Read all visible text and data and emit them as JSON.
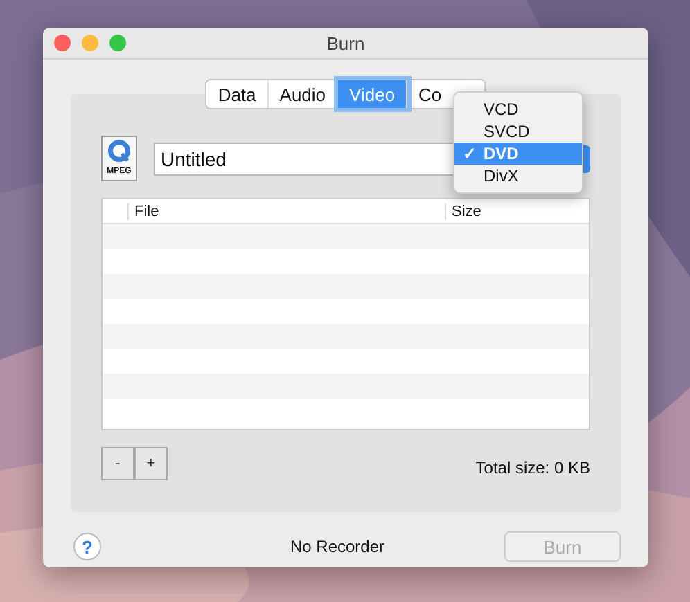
{
  "window": {
    "title": "Burn"
  },
  "tabs": [
    {
      "label": "Data",
      "selected": false
    },
    {
      "label": "Audio",
      "selected": false
    },
    {
      "label": "Video",
      "selected": true
    },
    {
      "label": "Co",
      "selected": false
    }
  ],
  "disc_name": {
    "value": "Untitled"
  },
  "format_menu": [
    {
      "label": "VCD",
      "selected": false
    },
    {
      "label": "SVCD",
      "selected": false
    },
    {
      "label": "DVD",
      "selected": true,
      "check": "✓"
    },
    {
      "label": "DivX",
      "selected": false
    }
  ],
  "file_icon_label": "MPEG",
  "table": {
    "columns": [
      "File",
      "Size"
    ]
  },
  "list_buttons": [
    "-",
    "+"
  ],
  "total_size": "Total size: 0 KB",
  "help_button": "?",
  "recorder_status": "No Recorder",
  "burn_button": {
    "label": "Burn",
    "disabled": true
  }
}
